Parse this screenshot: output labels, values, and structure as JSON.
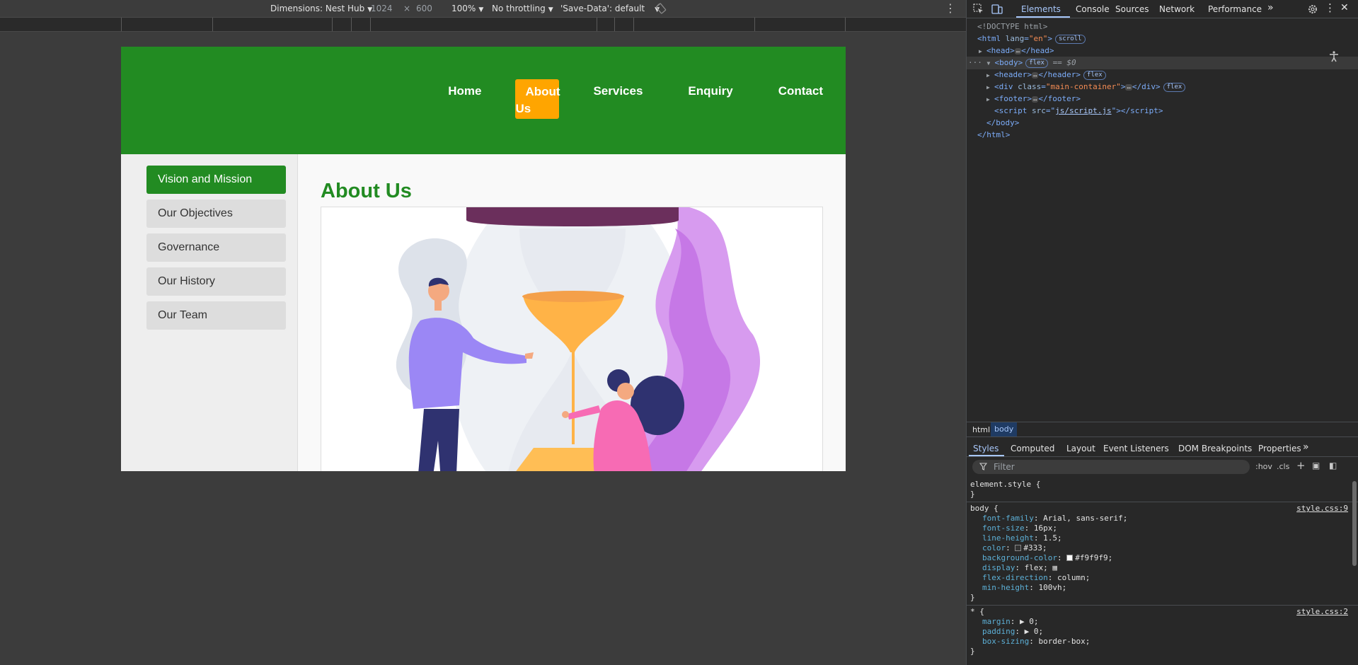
{
  "device_toolbar": {
    "dimensions_label": "Dimensions: Nest Hub",
    "width": "1024",
    "times": "×",
    "height": "600",
    "zoom": "100%",
    "throttling": "No throttling",
    "save_data": "'Save-Data': default"
  },
  "site": {
    "nav": {
      "home": "Home",
      "about_line1": "About",
      "about_line2": "Us",
      "services": "Services",
      "enquiry": "Enquiry",
      "contact": "Contact"
    },
    "sidebar": {
      "items": [
        {
          "label": "Vision and Mission"
        },
        {
          "label": "Our Objectives"
        },
        {
          "label": "Governance"
        },
        {
          "label": "Our History"
        },
        {
          "label": "Our Team"
        }
      ]
    },
    "content": {
      "title": "About Us"
    },
    "colors": {
      "brand_green": "#228b22",
      "accent_orange": "#ffa500"
    }
  },
  "devtools": {
    "tabs": [
      "Elements",
      "Console",
      "Sources",
      "Network",
      "Performance"
    ],
    "dom": {
      "doctype": "<!DOCTYPE html>",
      "html_open_tag": "<html ",
      "html_attr": "lang",
      "html_attr_val": "\"en\"",
      "html_badge": "scroll",
      "head": "head",
      "body": "body",
      "body_badge": "flex",
      "body_marker": "== $0",
      "header": "header",
      "header_badge": "flex",
      "div_class": "class",
      "div_class_val": "\"main-container\"",
      "div_badge": "flex",
      "footer": "footer",
      "script_src_attr": "src",
      "script_src_val": "js/script.js",
      "body_close": "</body>",
      "html_close": "</html>"
    },
    "breadcrumbs": [
      "html",
      "body"
    ],
    "styles_tabs": [
      "Styles",
      "Computed",
      "Layout",
      "Event Listeners",
      "DOM Breakpoints",
      "Properties"
    ],
    "filter_placeholder": "Filter",
    "hov": ":hov",
    "cls": ".cls",
    "rules": {
      "element_style": "element.style {",
      "body_selector": "body {",
      "body_source": "style.css:9",
      "body_decls": [
        {
          "name": "font-family",
          "value": "Arial, sans-serif;"
        },
        {
          "name": "font-size",
          "value": "16px;"
        },
        {
          "name": "line-height",
          "value": "1.5;"
        },
        {
          "name": "color",
          "value": "#333;"
        },
        {
          "name": "background-color",
          "value": "#f9f9f9;"
        },
        {
          "name": "display",
          "value": "flex;"
        },
        {
          "name": "flex-direction",
          "value": "column;"
        },
        {
          "name": "min-height",
          "value": "100vh;"
        }
      ],
      "star_selector": "* {",
      "star_source": "style.css:2",
      "star_decls": [
        {
          "name": "margin",
          "value": "▶ 0;"
        },
        {
          "name": "padding",
          "value": "▶ 0;"
        },
        {
          "name": "box-sizing",
          "value": "border-box;"
        }
      ],
      "close": "}"
    }
  }
}
